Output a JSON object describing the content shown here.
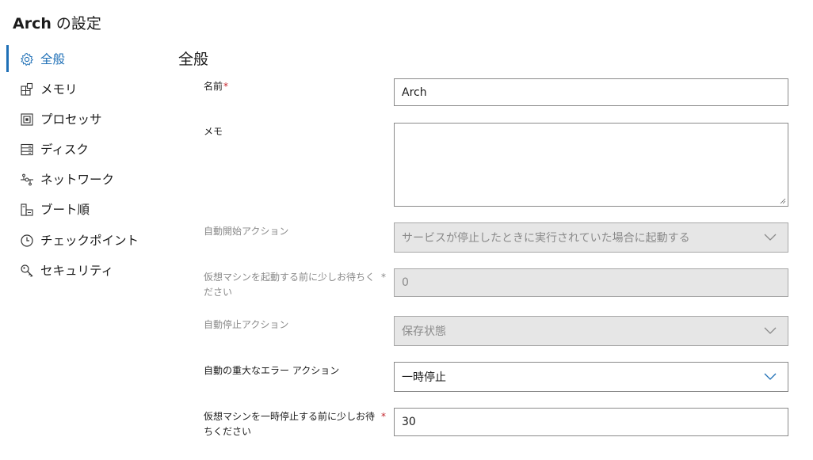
{
  "window": {
    "title_name": "Arch",
    "title_suffix": " の設定"
  },
  "nav": {
    "items": [
      {
        "label": "全般",
        "icon": "gear-icon",
        "active": true
      },
      {
        "label": "メモリ",
        "icon": "memory-icon"
      },
      {
        "label": "プロセッサ",
        "icon": "processor-icon"
      },
      {
        "label": "ディスク",
        "icon": "disk-icon"
      },
      {
        "label": "ネットワーク",
        "icon": "network-icon"
      },
      {
        "label": "ブート順",
        "icon": "boot-order-icon"
      },
      {
        "label": "チェックポイント",
        "icon": "clock-icon"
      },
      {
        "label": "セキュリティ",
        "icon": "key-icon"
      }
    ]
  },
  "section": {
    "title": "全般"
  },
  "form": {
    "name": {
      "label": "名前",
      "required_mark": "*",
      "value": "Arch"
    },
    "memo": {
      "label": "メモ",
      "value": ""
    },
    "auto_start": {
      "label": "自動開始アクション",
      "value": "サービスが停止したときに実行されていた場合に起動する",
      "disabled": true
    },
    "start_delay": {
      "label": "仮想マシンを起動する前に少しお待ちください",
      "required_mark": "*",
      "value": "0",
      "disabled": true
    },
    "auto_stop": {
      "label": "自動停止アクション",
      "value": "保存状態",
      "disabled": true
    },
    "critical_error": {
      "label": "自動の重大なエラー アクション",
      "value": "一時停止"
    },
    "pause_wait": {
      "label": "仮想マシンを一時停止する前に少しお待ちください",
      "required_mark": "*",
      "value": "30"
    }
  },
  "colors": {
    "accent": "#1e6fb6",
    "required": "#c4262e",
    "disabled_bg": "#e6e6e6",
    "disabled_text": "#8a8a8a"
  }
}
